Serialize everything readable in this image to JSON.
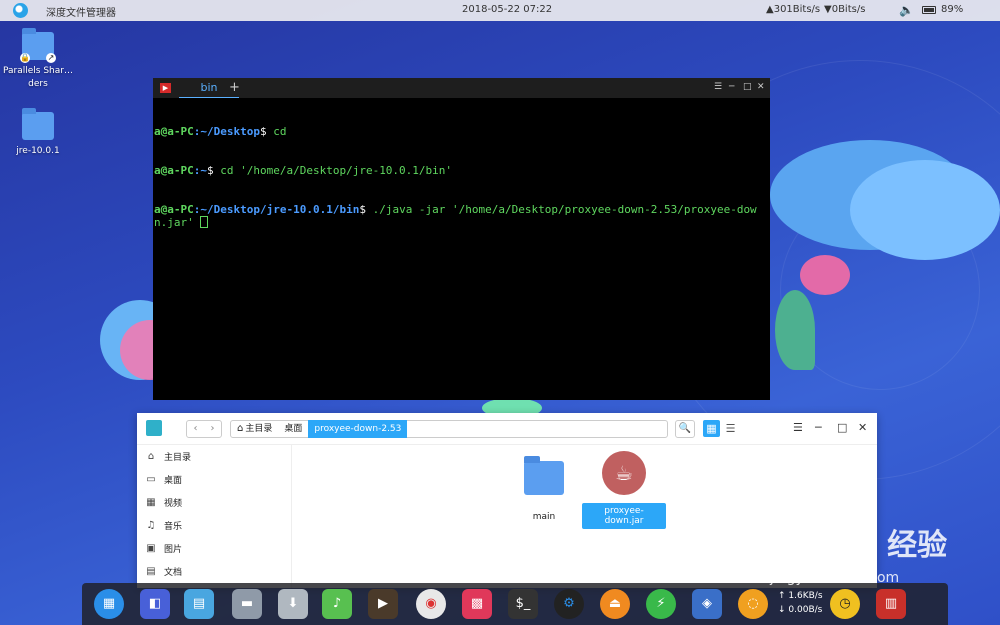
{
  "top_panel": {
    "app_title": "深度文件管理器",
    "clock": "2018-05-22 07:22",
    "net_up": "301Bits/s",
    "net_down": "0Bits/s",
    "battery": "89%"
  },
  "desktop_icons": [
    {
      "label": "Parallels Shar…ders"
    },
    {
      "label": "jre-10.0.1"
    }
  ],
  "terminal": {
    "tab_title": "bin",
    "lines": [
      {
        "user": "a@a-PC",
        "path": ":~/Desktop",
        "prompt": "$",
        "cmd": " cd"
      },
      {
        "user": "a@a-PC",
        "path": ":~",
        "prompt": "$",
        "cmd": " cd '/home/a/Desktop/jre-10.0.1/bin'"
      },
      {
        "user": "a@a-PC",
        "path": ":~/Desktop/jre-10.0.1/bin",
        "prompt": "$",
        "cmd": " ./java -jar '/home/a/Desktop/proxyee-down-2.53/proxyee-down.jar' "
      }
    ]
  },
  "file_manager": {
    "breadcrumbs": [
      "主目录",
      "桌面",
      "proxyee-down-2.53"
    ],
    "sidebar": [
      {
        "icon": "home-icon",
        "glyph": "⌂",
        "label": "主目录"
      },
      {
        "icon": "desktop-icon",
        "glyph": "▭",
        "label": "桌面"
      },
      {
        "icon": "video-icon",
        "glyph": "▦",
        "label": "视频"
      },
      {
        "icon": "music-icon",
        "glyph": "♫",
        "label": "音乐"
      },
      {
        "icon": "picture-icon",
        "glyph": "▣",
        "label": "图片"
      },
      {
        "icon": "document-icon",
        "glyph": "▤",
        "label": "文档"
      }
    ],
    "files": [
      {
        "name": "main",
        "type": "folder"
      },
      {
        "name": "proxyee-down.jar",
        "type": "jar",
        "selected": true
      }
    ]
  },
  "dock": {
    "speed_up": "↑ 1.6KB/s",
    "speed_down": "↓ 0.00B/s"
  },
  "watermark": {
    "brand": "Bai du 经验",
    "url": "jingyan.baidu.com"
  }
}
